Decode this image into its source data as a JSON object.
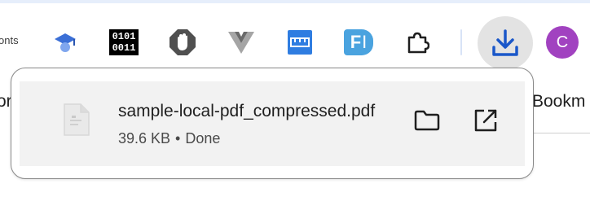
{
  "toolbar": {
    "fonts_label": "onts",
    "extensions": [
      {
        "icon": "graduation-cap-icon"
      },
      {
        "icon": "binary-icon",
        "line1": "0101",
        "line2": "0011"
      },
      {
        "icon": "hand-stop-icon"
      },
      {
        "icon": "vue-devtools-icon"
      },
      {
        "icon": "ruler-icon"
      },
      {
        "icon": "text-cursor-icon",
        "letter": "F"
      },
      {
        "icon": "puzzle-piece-icon"
      }
    ],
    "download_icon": "download-icon",
    "avatar_letter": "C",
    "avatar_color": "#a142c0",
    "accent_color": "#1a57c9"
  },
  "page": {
    "left_text": "or",
    "right_text": "Bookm"
  },
  "download": {
    "filename": "sample-local-pdf_compressed.pdf",
    "size": "39.6 KB",
    "separator": "•",
    "state": "Done",
    "file_icon": "pdf-file-icon",
    "show_in_folder_icon": "folder-icon",
    "open_icon": "open-external-icon"
  }
}
